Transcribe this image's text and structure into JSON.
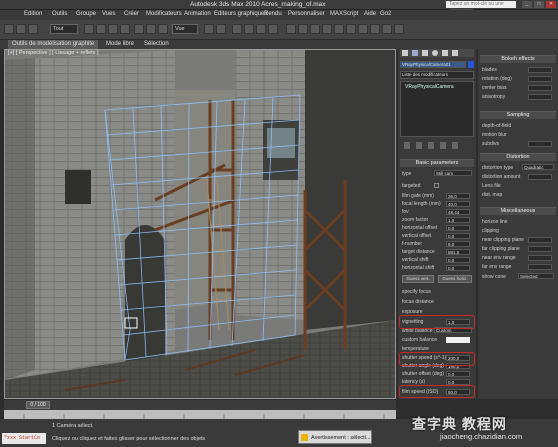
{
  "window": {
    "title": "Autodesk 3ds Max 2010     Acres_making_of.max",
    "search_placeholder": "Tapez un mot-clé ou une expression",
    "min": "_",
    "max": "□",
    "close": "✕"
  },
  "menu": [
    "Edition",
    "Outils",
    "Groupe",
    "Vues",
    "Créer",
    "Modificateurs",
    "Animation",
    "Editeurs graphiques",
    "Rendu",
    "Personnaliser",
    "MAXScript",
    "Aide",
    "Go2"
  ],
  "toolbar": {
    "selection_filter": "Tout",
    "ref_coord": "Vue"
  },
  "ribbon": {
    "tabs": [
      "Outils de modélisation graphite",
      "Mode libre",
      "Sélection"
    ]
  },
  "viewport": {
    "label": "[+] [ Perspective ] [ Lissage + reflets ]"
  },
  "command_panel": {
    "object_name": "VRayPhysicalCamera01",
    "modifier_list": "Liste des modificateurs",
    "stack_item": "VRayPhysicalCamera",
    "basic_params_header": "Basic parameters",
    "params": [
      {
        "label": "type",
        "value": "Still cam"
      },
      {
        "label": "targeted",
        "value": ""
      },
      {
        "label": "film gate (mm)",
        "value": "36,0"
      },
      {
        "label": "focal length (mm)",
        "value": "40,0"
      },
      {
        "label": "fov",
        "value": "48,44"
      },
      {
        "label": "zoom factor",
        "value": "1,0"
      },
      {
        "label": "horizontal offset",
        "value": "0,0"
      },
      {
        "label": "vertical offset",
        "value": "0,0"
      },
      {
        "label": "f-number",
        "value": "8,0"
      },
      {
        "label": "target distance",
        "value": "881,5"
      },
      {
        "label": "vertical shift",
        "value": "0,0"
      },
      {
        "label": "horizontal shift",
        "value": "0,0"
      }
    ],
    "guess_vert": "Guess vert.",
    "guess_horiz": "Guess horiz.",
    "specify_focus": "specify focus",
    "focus_distance": "focus distance",
    "exposure": "exposure",
    "vignetting": {
      "label": "vignetting",
      "value": "1,0"
    },
    "white_balance": {
      "label": "white balance",
      "value": "Custom"
    },
    "custom_balance": "custom balance",
    "temperature": "temperature",
    "shutter_speed": {
      "label": "shutter speed (s^-1)",
      "value": "200,0"
    },
    "shutter_angle": {
      "label": "shutter angle (deg)",
      "value": "180,0"
    },
    "shutter_offset": {
      "label": "shutter offset (deg)",
      "value": "0,0"
    },
    "latency": {
      "label": "latency (s)",
      "value": "0,0"
    },
    "film_speed": {
      "label": "film speed (ISO)",
      "value": "50,0"
    }
  },
  "right_panel": {
    "bokeh_header": "Bokeh effects",
    "bokeh": [
      "blades",
      "rotation (deg)",
      "center bias",
      "anisotropy"
    ],
    "sampling_header": "Sampling",
    "sampling": [
      "depth-of-field",
      "motion blur",
      "subdivs"
    ],
    "distortion_header": "Distortion",
    "distortion_type": {
      "label": "distortion type",
      "value": "Quadratic"
    },
    "distortion_amount": "distortion amount",
    "lens_file": "Lens file",
    "dist_map": "dist. map",
    "misc_header": "Miscellaneous",
    "misc": [
      "horizon line",
      "clipping",
      "near clipping plane",
      "far clipping plane",
      "near env range",
      "far env range"
    ],
    "show_cone": {
      "label": "show cone",
      "value": "Selected"
    }
  },
  "timeline": {
    "frame": "0 / 100"
  },
  "status": {
    "maxscript": "\"xxx StartCo",
    "line1": "1 Caméra sélect.",
    "line2": "Cliquez ou cliquez et faites glisser pour sélectionner des objets",
    "warning": "Avertissement : sélecti..."
  },
  "watermark": {
    "line1": "查字典 教程网",
    "line2": "jiaocheng.chazidian.com"
  },
  "colors": {
    "highlight_box": "#c8262c",
    "viewport_bg": "#6b6b6b",
    "grid_lines": "#8fc4ff"
  }
}
